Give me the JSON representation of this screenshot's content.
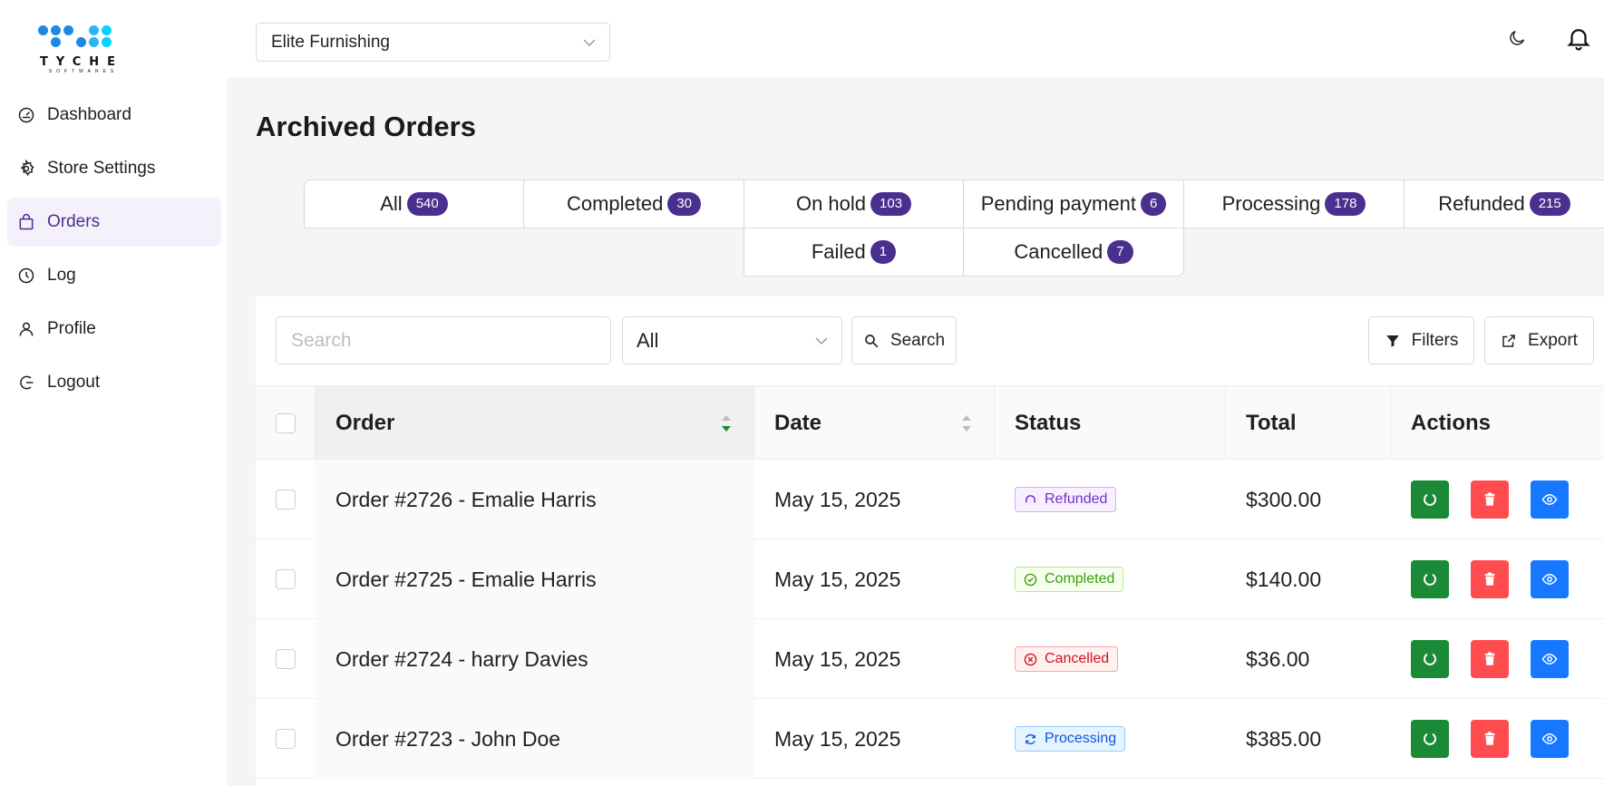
{
  "brand": {
    "name": "TYCHE",
    "tagline": "SOFTWARES",
    "colors": [
      "#1e88e5",
      "#1e88e5",
      "#29b6f6",
      "#00c8f0",
      "#00d4ff"
    ]
  },
  "sidebar": {
    "items": [
      {
        "label": "Dashboard",
        "icon": "dashboard-gauge-icon",
        "active": false
      },
      {
        "label": "Store Settings",
        "icon": "gear-icon",
        "active": false
      },
      {
        "label": "Orders",
        "icon": "shopping-bag-icon",
        "active": true
      },
      {
        "label": "Log",
        "icon": "clock-icon",
        "active": false
      },
      {
        "label": "Profile",
        "icon": "user-icon",
        "active": false
      },
      {
        "label": "Logout",
        "icon": "logout-icon",
        "active": false
      }
    ]
  },
  "topbar": {
    "store": "Elite Furnishing",
    "theme_icon": "moon-icon",
    "notification_icon": "bell-icon"
  },
  "page": {
    "title": "Archived Orders"
  },
  "tabs": [
    {
      "label": "All",
      "count": "540"
    },
    {
      "label": "Completed",
      "count": "30"
    },
    {
      "label": "On hold",
      "count": "103"
    },
    {
      "label": "Pending payment",
      "count": "6"
    },
    {
      "label": "Processing",
      "count": "178"
    },
    {
      "label": "Refunded",
      "count": "215"
    },
    {
      "label": "Failed",
      "count": "1"
    },
    {
      "label": "Cancelled",
      "count": "7"
    }
  ],
  "toolbar": {
    "search_placeholder": "Search",
    "status_value": "All",
    "search_button": "Search",
    "filters_button": "Filters",
    "export_button": "Export"
  },
  "table": {
    "columns": {
      "order": "Order",
      "date": "Date",
      "status": "Status",
      "total": "Total",
      "actions": "Actions"
    },
    "rows": [
      {
        "order": "Order #2726 - Emalie Harris",
        "date": "May 15, 2025",
        "status": "Refunded",
        "total": "$300.00"
      },
      {
        "order": "Order #2725 - Emalie Harris",
        "date": "May 15, 2025",
        "status": "Completed",
        "total": "$140.00"
      },
      {
        "order": "Order #2724 - harry Davies",
        "date": "May 15, 2025",
        "status": "Cancelled",
        "total": "$36.00"
      },
      {
        "order": "Order #2723 - John Doe",
        "date": "May 15, 2025",
        "status": "Processing",
        "total": "$385.00"
      }
    ]
  },
  "status_colors": {
    "Refunded": {
      "fg": "#722ed1",
      "bg": "#f9f0ff",
      "border": "#d3adf7"
    },
    "Completed": {
      "fg": "#389e0d",
      "bg": "#f6ffed",
      "border": "#b7eb8f"
    },
    "Cancelled": {
      "fg": "#cf1322",
      "bg": "#fff1f0",
      "border": "#ffa39e"
    },
    "Processing": {
      "fg": "#0958d9",
      "bg": "#e6f4ff",
      "border": "#91caff"
    }
  },
  "action_colors": {
    "restore": "#1a8a36",
    "delete": "#ff4d4f",
    "view": "#1677ff"
  },
  "accent": "#4a2f8f"
}
